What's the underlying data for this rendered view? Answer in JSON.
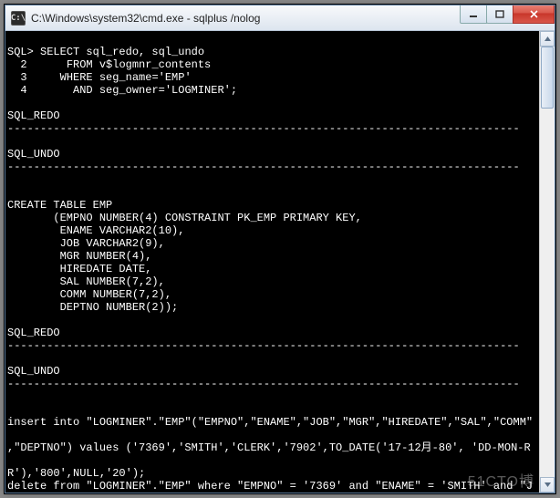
{
  "window": {
    "title": "C:\\Windows\\system32\\cmd.exe - sqlplus  /nolog",
    "icon_glyph": "C:\\"
  },
  "watermark": "51CTO博",
  "separator": "------------------------------------------------------------------------------",
  "console": {
    "prompt": "SQL>",
    "query_l1": "SELECT sql_redo, sql_undo",
    "query_n2": "2",
    "query_l2": "FROM v$logmnr_contents",
    "query_n3": "3",
    "query_l3": "WHERE seg_name='EMP'",
    "query_n4": "4",
    "query_l4": "AND seg_owner='LOGMINER';",
    "hdr_redo": "SQL_REDO",
    "hdr_undo": "SQL_UNDO",
    "create_1": "CREATE TABLE EMP",
    "create_2": "       (EMPNO NUMBER(4) CONSTRAINT PK_EMP PRIMARY KEY,",
    "create_3": "        ENAME VARCHAR2(10),",
    "create_4": "        JOB VARCHAR2(9),",
    "create_5": "        MGR NUMBER(4),",
    "create_6": "        HIREDATE DATE,",
    "create_7": "        SAL NUMBER(7,2),",
    "create_8": "        COMM NUMBER(7,2),",
    "create_9": "        DEPTNO NUMBER(2));",
    "insert_1": "insert into \"LOGMINER\".\"EMP\"(\"EMPNO\",\"ENAME\",\"JOB\",\"MGR\",\"HIREDATE\",\"SAL\",\"COMM\"",
    "insert_2": ",\"DEPTNO\") values ('7369','SMITH','CLERK','7902',TO_DATE('17-12月-80', 'DD-MON-R",
    "insert_3": "R'),'800',NULL,'20');",
    "delete_1": "delete from \"LOGMINER\".\"EMP\" where \"EMPNO\" = '7369' and \"ENAME\" = 'SMITH' and \"J"
  }
}
